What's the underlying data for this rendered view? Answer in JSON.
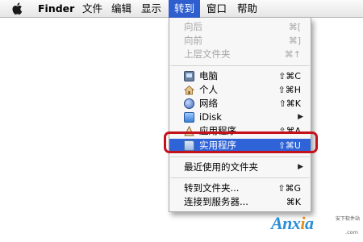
{
  "menubar": {
    "apple_icon": "apple-logo",
    "items": [
      {
        "label": "Finder"
      },
      {
        "label": "文件"
      },
      {
        "label": "编辑"
      },
      {
        "label": "显示"
      },
      {
        "label": "转到"
      },
      {
        "label": "窗口"
      },
      {
        "label": "帮助"
      }
    ]
  },
  "go_menu": {
    "items": [
      {
        "label": "向后",
        "shortcut": "⌘[",
        "disabled": true
      },
      {
        "label": "向前",
        "shortcut": "⌘]",
        "disabled": true
      },
      {
        "label": "上层文件夹",
        "shortcut": "⌘↑",
        "disabled": true
      },
      {
        "label": "电脑",
        "shortcut": "⇧⌘C",
        "icon": "computer-icon"
      },
      {
        "label": "个人",
        "shortcut": "⇧⌘H",
        "icon": "home-icon"
      },
      {
        "label": "网络",
        "shortcut": "⇧⌘K",
        "icon": "network-globe-icon"
      },
      {
        "label": "iDisk",
        "icon": "idisk-icon"
      },
      {
        "label": "应用程序",
        "shortcut": "⇧⌘A",
        "icon": "applications-icon"
      },
      {
        "label": "实用程序",
        "shortcut": "⇧⌘U",
        "icon": "utilities-folder-icon",
        "selected": true
      },
      {
        "label": "最近使用的文件夹"
      },
      {
        "label": "转到文件夹...",
        "shortcut": "⇧⌘G"
      },
      {
        "label": "连接到服务器...",
        "shortcut": "⌘K"
      }
    ]
  },
  "colors": {
    "selection": "#2f63d8",
    "highlight_border": "#c3121b",
    "disabled_text": "#a6a6a6"
  },
  "watermark": {
    "brand_prefix": "Anx",
    "brand_accent": "i",
    "brand_suffix": "a",
    "tagline": "安下软件站",
    "url": ".com"
  }
}
